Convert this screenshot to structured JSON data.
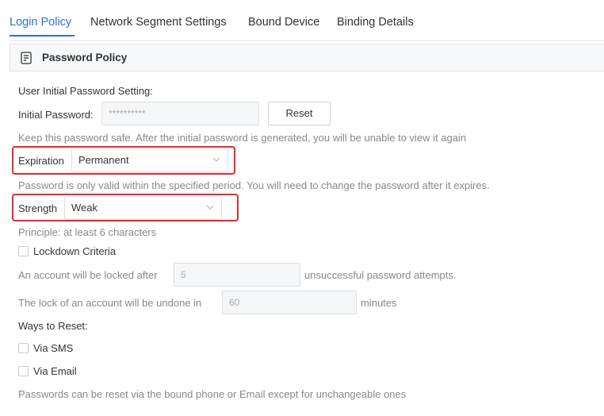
{
  "tabs": [
    {
      "label": "Login Policy",
      "active": true
    },
    {
      "label": "Network Segment Settings",
      "active": false
    },
    {
      "label": "Bound Device",
      "active": false
    },
    {
      "label": "Binding Details",
      "active": false
    }
  ],
  "section": {
    "title": "Password Policy",
    "icon": "document-list-icon"
  },
  "initial_password": {
    "heading": "User Initial Password Setting:",
    "label": "Initial Password:",
    "value": "**********",
    "reset_label": "Reset",
    "note": "Keep this password safe. After the initial password is generated, you will be unable to view it again"
  },
  "expiration": {
    "label": "Expiration",
    "value": "Permanent",
    "note": "Password is only valid within the specified period. You will need to change the password after it expires."
  },
  "strength": {
    "label": "Strength",
    "value": "Weak",
    "note": "Principle: at least 6 characters"
  },
  "lockdown": {
    "label": "Lockdown Criteria",
    "checked": false,
    "attempts_prefix": "An account will be locked after",
    "attempts_value": "5",
    "attempts_suffix": "unsuccessful password attempts.",
    "unlock_prefix": "The lock of an account will be undone in",
    "unlock_value": "60",
    "unlock_suffix": "minutes"
  },
  "reset_ways": {
    "heading": "Ways to Reset:",
    "sms_label": "Via SMS",
    "sms_checked": false,
    "email_label": "Via Email",
    "email_checked": false,
    "note": "Passwords can be reset via the bound phone or Email except for unchangeable ones"
  },
  "colors": {
    "accent": "#2f6fd6",
    "highlight": "#e32b2b",
    "muted_text": "#888888"
  }
}
